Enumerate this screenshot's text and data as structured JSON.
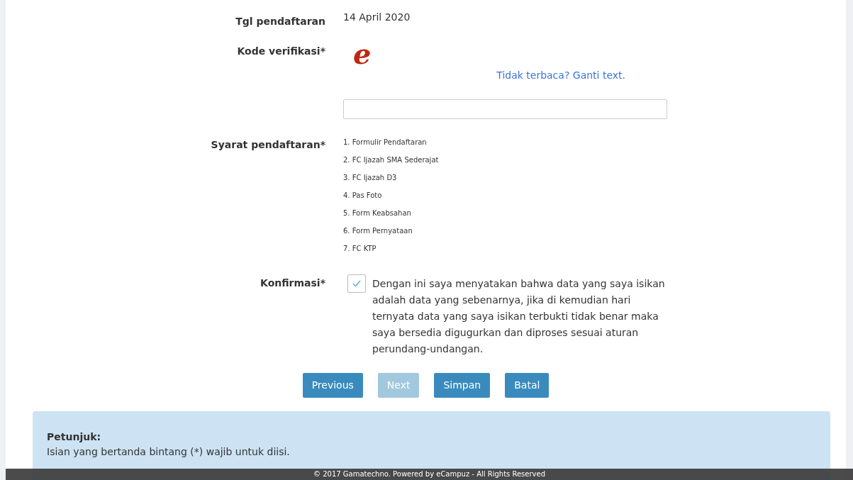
{
  "fields": [
    {
      "label": "Tgl pendaftaran",
      "kind": "text",
      "value": "14 April 2020"
    },
    {
      "label": "Kode verifikasi*",
      "kind": "captcha",
      "captcha_text": "e",
      "link": "Tidak terbaca? Ganti text."
    },
    {
      "label": "Syarat pendaftaran*",
      "kind": "list",
      "items": [
        "1. Formulir Pendaftaran",
        "2. FC Ijazah SMA Sederajat",
        "3. FC Ijazah D3",
        "4. Pas Foto",
        "5. Form Keabsahan",
        "6. Form Pernyataan",
        "7. FC KTP"
      ]
    },
    {
      "label": "Konfirmasi*",
      "kind": "checkbox",
      "checked": true,
      "text": "Dengan ini saya menyatakan bahwa data yang saya isikan adalah data yang sebenarnya, jika di kemudian hari ternyata data yang saya isikan terbukti tidak benar maka saya bersedia digugurkan dan diproses sesuai aturan perundang-undangan."
    }
  ],
  "buttons": [
    {
      "label": "Previous",
      "disabled": false
    },
    {
      "label": "Next",
      "disabled": true
    },
    {
      "label": "Simpan",
      "disabled": false
    },
    {
      "label": "Batal",
      "disabled": false
    }
  ],
  "hint": {
    "title": "Petunjuk:",
    "text": "Isian yang bertanda bintang (*) wajib untuk diisi."
  },
  "footer": "© 2017 Gamatechno. Powered by eCampuz - All Rights Reserved"
}
